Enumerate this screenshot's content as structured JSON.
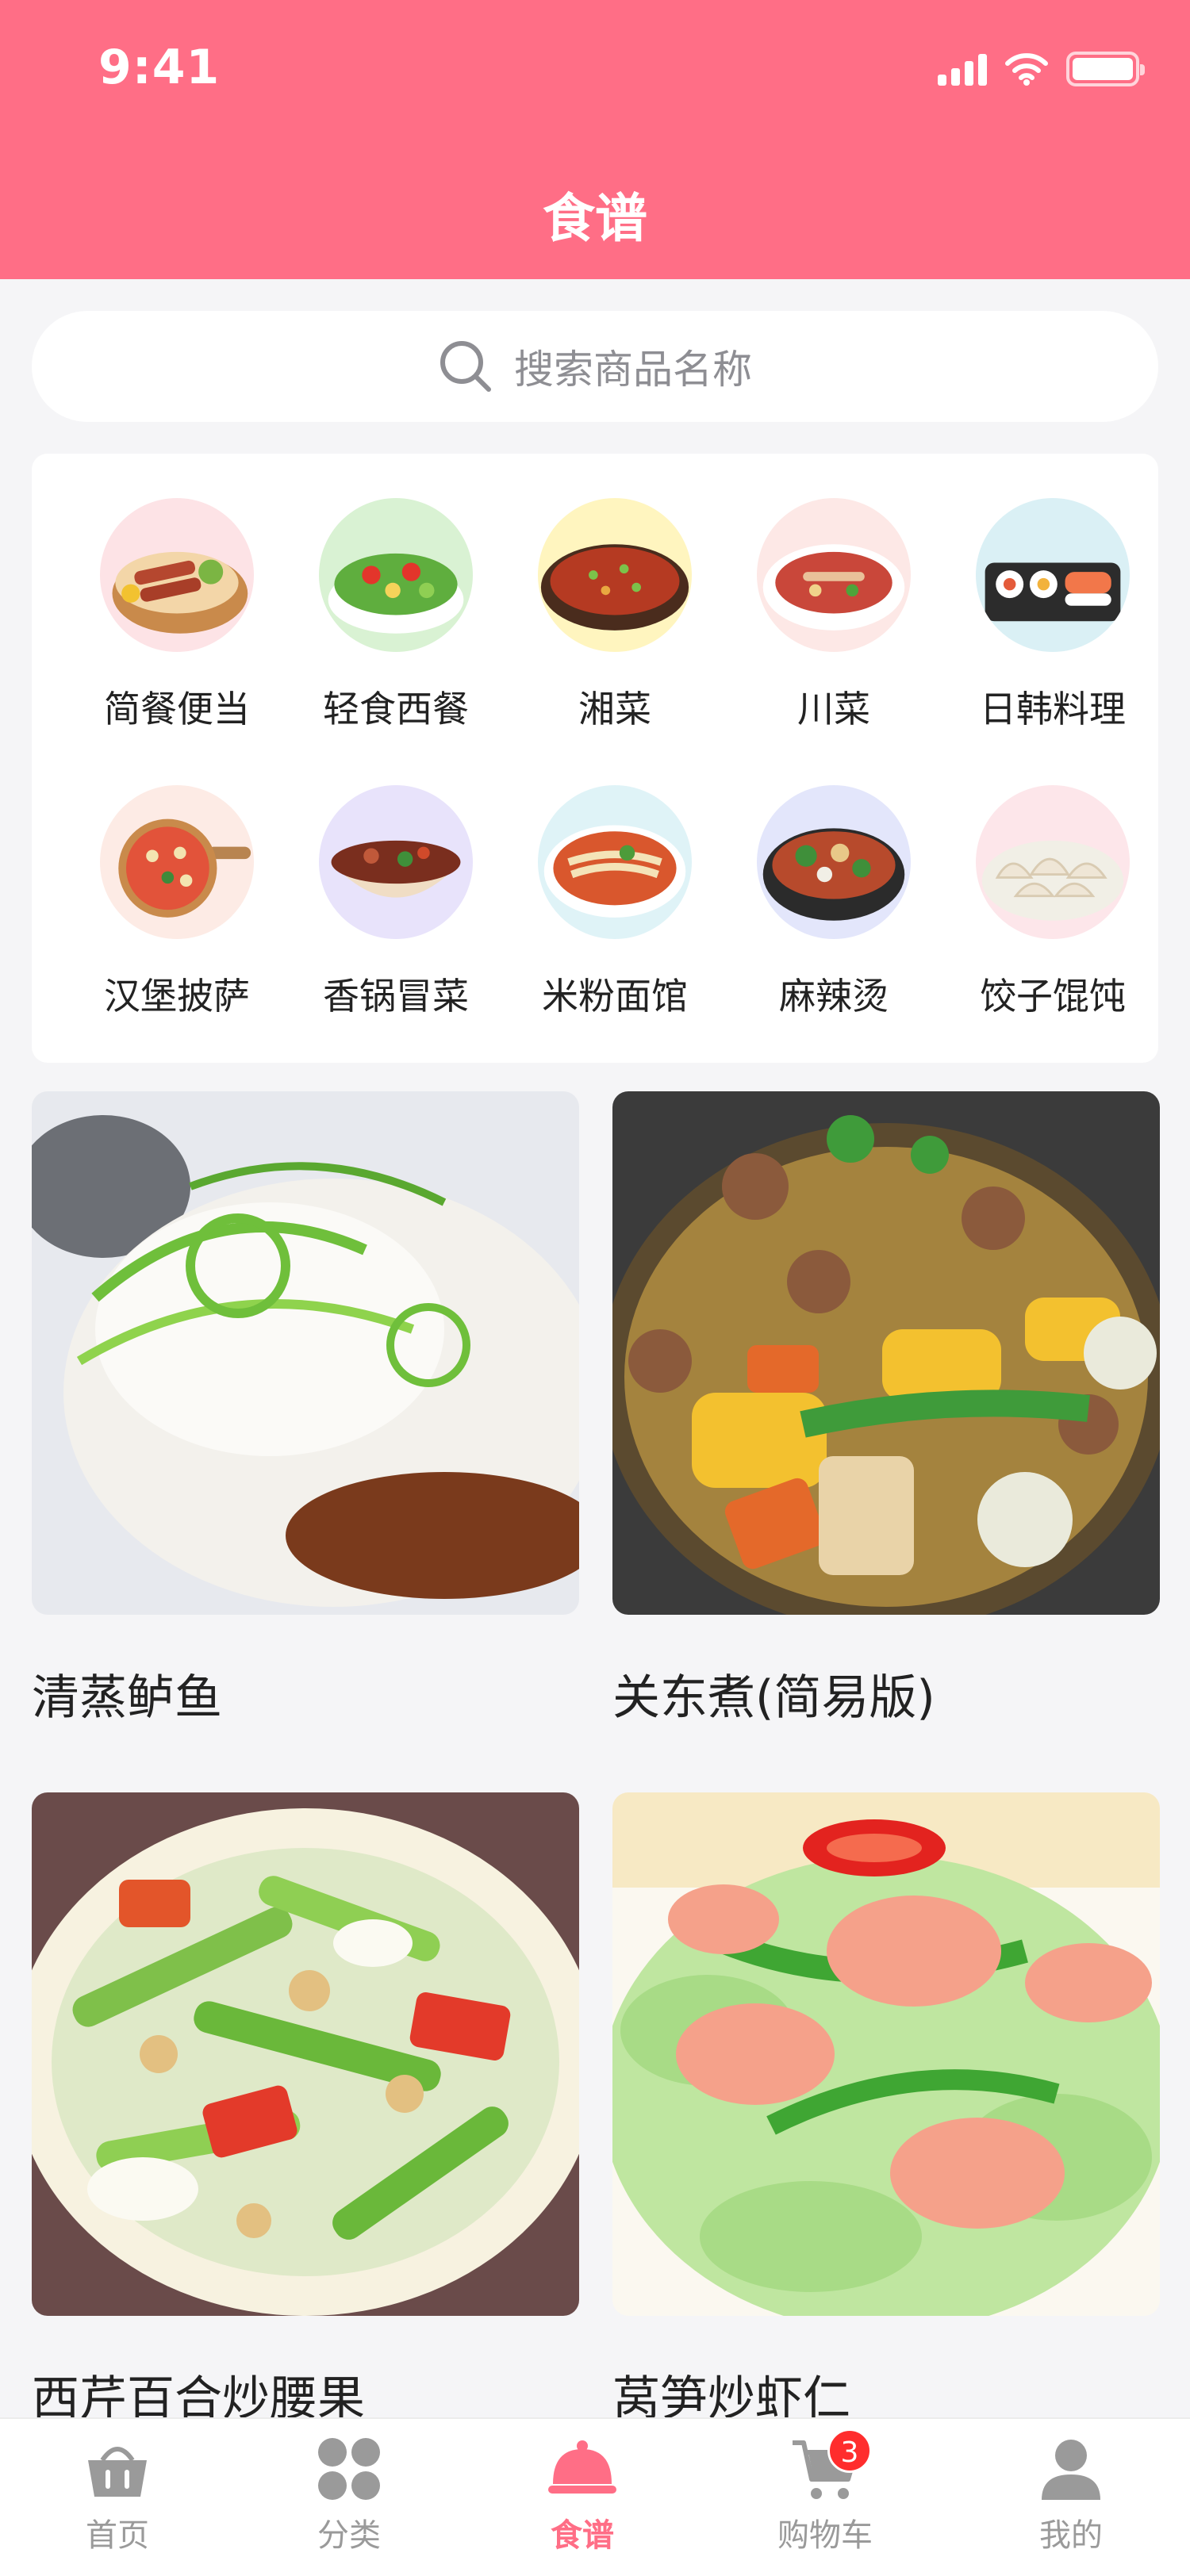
{
  "status_bar": {
    "time": "9:41"
  },
  "header": {
    "title": "食谱"
  },
  "search": {
    "placeholder": "搜索商品名称"
  },
  "categories": [
    {
      "label": "简餐便当",
      "icon": "bento-image"
    },
    {
      "label": "轻食西餐",
      "icon": "salad-image"
    },
    {
      "label": "湘菜",
      "icon": "hunan-dish-image"
    },
    {
      "label": "川菜",
      "icon": "sichuan-dish-image"
    },
    {
      "label": "日韩料理",
      "icon": "sushi-image"
    },
    {
      "label": "汉堡披萨",
      "icon": "pizza-image"
    },
    {
      "label": "香锅冒菜",
      "icon": "spicy-pot-image"
    },
    {
      "label": "米粉面馆",
      "icon": "noodle-image"
    },
    {
      "label": "麻辣烫",
      "icon": "malatang-image"
    },
    {
      "label": "饺子馄饨",
      "icon": "dumpling-image"
    }
  ],
  "recipes": [
    {
      "title": "清蒸鲈鱼"
    },
    {
      "title": "关东煮(简易版)"
    },
    {
      "title": "西芹百合炒腰果"
    },
    {
      "title": "莴笋炒虾仁"
    }
  ],
  "tabbar": {
    "items": [
      {
        "label": "首页",
        "icon": "basket-icon"
      },
      {
        "label": "分类",
        "icon": "grid-icon"
      },
      {
        "label": "食谱",
        "icon": "cloche-icon"
      },
      {
        "label": "购物车",
        "icon": "cart-icon",
        "badge": "3"
      },
      {
        "label": "我的",
        "icon": "user-icon"
      }
    ],
    "active_index": 2
  },
  "colors": {
    "accent": "#ff6e86",
    "badge": "#ff2d2d",
    "inactive": "#9a9a9a"
  }
}
